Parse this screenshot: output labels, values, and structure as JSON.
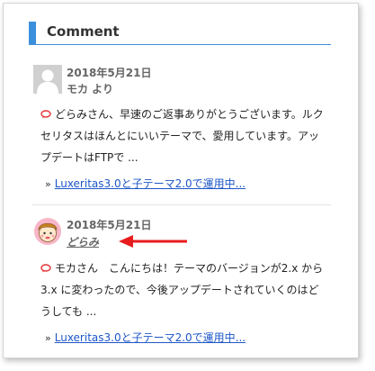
{
  "widget": {
    "title": "Comment"
  },
  "comments": [
    {
      "date": "2018年5月21日",
      "author": "モカ より",
      "excerpt_lines": [
        "どらみさん、早速のご返事ありがとうございます。ルク",
        "セリタスはほんとにいいテーマで、愛用しています。アッ",
        "プデートはFTPで ..."
      ],
      "post_link": "Luxeritas3.0と子テーマ2.0で運用中..."
    },
    {
      "date": "2018年5月21日",
      "author": "どらみ",
      "excerpt_lines": [
        "モカさん　こんにちは！テーマのバージョンが2.x から",
        "3.x に変わったので、今後アップデートされていくのはど",
        "うしても ..."
      ],
      "post_link": "Luxeritas3.0と子テーマ2.0で運用中..."
    }
  ],
  "colors": {
    "accent": "#3c8fdc",
    "link": "#1e57c8",
    "bubble_icon": "#e53333",
    "annotation_arrow": "#e81c1c"
  },
  "icons": {
    "default_avatar": "person-silhouette-icon",
    "author_avatar": "cartoon-girl-avatar-icon",
    "comment_bubble": "speech-bubble-icon",
    "link_marker": "double-chevron-right-icon",
    "annotation": "red-arrow-icon"
  }
}
